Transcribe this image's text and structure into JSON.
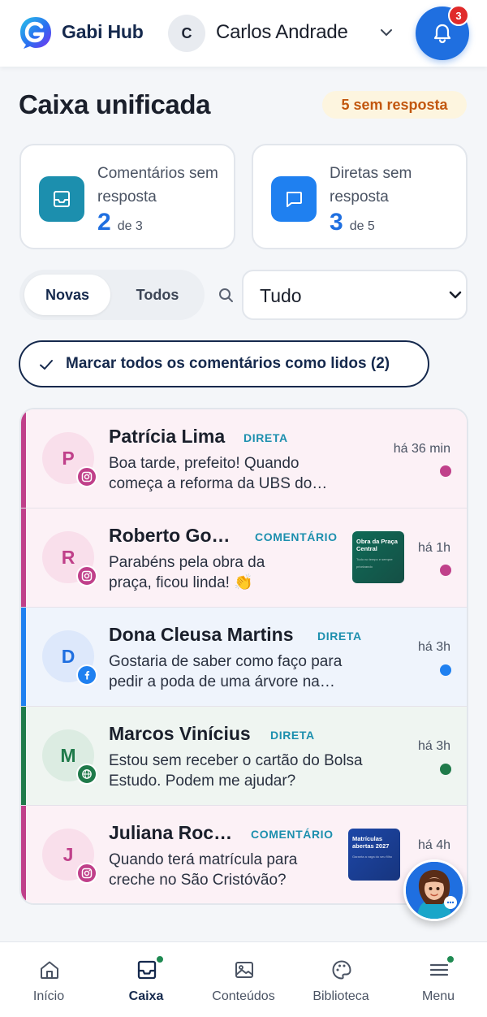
{
  "app": {
    "brand": "Gabi Hub",
    "user_initial": "C",
    "user_name": "Carlos Andrade",
    "notifications_count": "3",
    "colors": {
      "primary": "#1f6fe0",
      "navy": "#15294d",
      "instagram": "#c0408a",
      "facebook": "#1f80f0",
      "web": "#1f7a4a"
    }
  },
  "header": {
    "title": "Caixa unificada",
    "unanswered_badge": "5 sem resposta"
  },
  "stats": [
    {
      "label": "Comentários sem resposta",
      "count": "2",
      "of": "de 3",
      "icon": "inbox-icon"
    },
    {
      "label": "Diretas sem resposta",
      "count": "3",
      "of": "de 5",
      "icon": "chat-bubble-icon"
    }
  ],
  "filters": {
    "tabs": [
      {
        "label": "Novas",
        "active": true
      },
      {
        "label": "Todos",
        "active": false
      }
    ],
    "type_select": "Tudo"
  },
  "mark_all_label": "Marcar todos os comentários como lidos (2)",
  "messages": [
    {
      "initial": "P",
      "name": "Patrícia Lima",
      "type": "DIRETA",
      "network": "instagram",
      "text_line1": "Boa tarde, prefeito! Quando",
      "text_line2": "começa a reforma da UBS do…",
      "time": "há 36 min"
    },
    {
      "initial": "R",
      "name": "Roberto Go…",
      "type": "COMENTÁRIO",
      "network": "instagram",
      "text_line1": "Parabéns pela obra da",
      "text_line2": "praça, ficou linda! 👏",
      "time": "há 1h",
      "thumbnail_title": "Obra da Praça Central",
      "thumbnail_sub": "Tudo no tempo e sempre priorizando"
    },
    {
      "initial": "D",
      "name": "Dona Cleusa Martins",
      "type": "DIRETA",
      "network": "facebook",
      "text_line1": "Gostaria de saber como faço para",
      "text_line2": "pedir a poda de uma árvore na…",
      "time": "há 3h"
    },
    {
      "initial": "M",
      "name": "Marcos Vinícius",
      "type": "DIRETA",
      "network": "web",
      "text_line1": "Estou sem receber o cartão do Bolsa",
      "text_line2": "Estudo. Podem me ajudar?",
      "time": "há 3h"
    },
    {
      "initial": "J",
      "name": "Juliana Roc…",
      "type": "COMENTÁRIO",
      "network": "instagram",
      "text_line1": "Quando terá matrícula para",
      "text_line2": "creche no São Cristóvão?",
      "time": "há 4h",
      "thumbnail_title": "Matrículas abertas 2027",
      "thumbnail_sub": "Garanta a vaga do seu filho"
    }
  ],
  "nav": [
    {
      "label": "Início",
      "icon": "home-icon"
    },
    {
      "label": "Caixa",
      "icon": "inbox-icon",
      "active": true
    },
    {
      "label": "Conteúdos",
      "icon": "image-icon"
    },
    {
      "label": "Biblioteca",
      "icon": "palette-icon"
    },
    {
      "label": "Menu",
      "icon": "menu-icon"
    }
  ]
}
